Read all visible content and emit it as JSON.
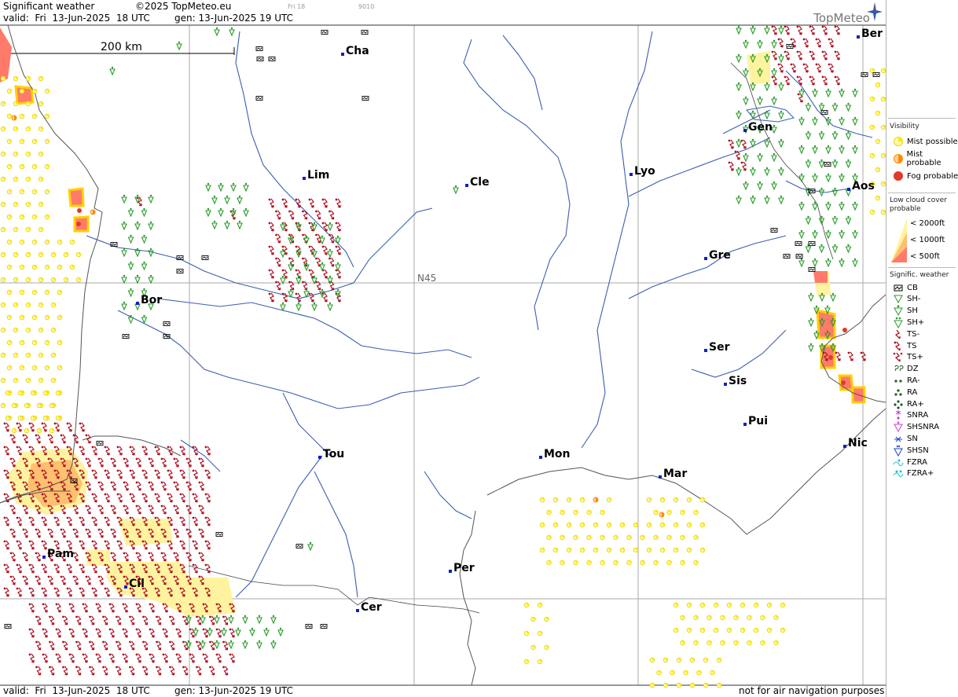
{
  "header": {
    "title": "Significant weather",
    "copyright": "©2025 TopMeteo.eu",
    "small_a": "Fri 18",
    "small_b": "9010",
    "valid": "valid:  Fri  13-Jun-2025  18 UTC",
    "gen": "gen: 13-Jun-2025 19 UTC",
    "logo": "TopMeteo"
  },
  "map": {
    "scale_label": "200 km",
    "lat_label": "N45",
    "colors": {
      "river": "#3a5fb0",
      "coast": "#555555",
      "grid": "#a9a9a9",
      "ts": "#b01020",
      "sh": "#2a9a2a",
      "mist": "#ffe600",
      "fog": "#e03a2a"
    },
    "cities": [
      {
        "name": "Cha"
      },
      {
        "name": "Ber"
      },
      {
        "name": "Gen"
      },
      {
        "name": "Lim"
      },
      {
        "name": "Cle"
      },
      {
        "name": "Lyo"
      },
      {
        "name": "Aos"
      },
      {
        "name": "Gre"
      },
      {
        "name": "Bor"
      },
      {
        "name": "Ser"
      },
      {
        "name": "Sis"
      },
      {
        "name": "Pui"
      },
      {
        "name": "Tou"
      },
      {
        "name": "Mon"
      },
      {
        "name": "Nic"
      },
      {
        "name": "Mar"
      },
      {
        "name": "Pam"
      },
      {
        "name": "Cil"
      },
      {
        "name": "Per"
      },
      {
        "name": "Cer"
      }
    ]
  },
  "legend": {
    "visibility": {
      "title": "Visibility",
      "items": [
        {
          "label": "Mist possible",
          "icon": "mist-possible-icon",
          "color": "#ffe600"
        },
        {
          "label": "Mist probable",
          "icon": "mist-probable-icon",
          "color": "#ff8a00"
        },
        {
          "label": "Fog probable",
          "icon": "fog-probable-icon",
          "color": "#e03a2a"
        }
      ]
    },
    "low_cloud": {
      "title_1": "Low cloud cover",
      "title_2": "probable",
      "items": [
        {
          "label": "< 2000ft",
          "color": "#fff3a0"
        },
        {
          "label": "< 1000ft",
          "color": "#ffc070"
        },
        {
          "label": "<   500ft",
          "color": "#ff7a6a"
        }
      ]
    },
    "sigwx": {
      "title": "Signific. weather",
      "items": [
        {
          "label": "CB",
          "icon": "cb-icon"
        },
        {
          "label": "SH-",
          "icon": "sh-light-icon"
        },
        {
          "label": "SH",
          "icon": "sh-icon"
        },
        {
          "label": "SH+",
          "icon": "sh-heavy-icon"
        },
        {
          "label": "TS-",
          "icon": "ts-light-icon"
        },
        {
          "label": "TS",
          "icon": "ts-icon"
        },
        {
          "label": "TS+",
          "icon": "ts-heavy-icon"
        },
        {
          "label": "DZ",
          "icon": "dz-icon"
        },
        {
          "label": "RA-",
          "icon": "ra-light-icon"
        },
        {
          "label": "RA",
          "icon": "ra-icon"
        },
        {
          "label": "RA+",
          "icon": "ra-heavy-icon"
        },
        {
          "label": "SNRA",
          "icon": "snra-icon"
        },
        {
          "label": "SHSNRA",
          "icon": "shsnra-icon"
        },
        {
          "label": "SN",
          "icon": "sn-icon"
        },
        {
          "label": "SHSN",
          "icon": "shsn-icon"
        },
        {
          "label": "FZRA",
          "icon": "fzra-icon"
        },
        {
          "label": "FZRA+",
          "icon": "fzra-heavy-icon"
        }
      ]
    }
  },
  "footer": {
    "valid": "valid:  Fri  13-Jun-2025  18 UTC",
    "gen": "gen: 13-Jun-2025 19 UTC",
    "disclaimer": "not for air navigation purposes"
  }
}
